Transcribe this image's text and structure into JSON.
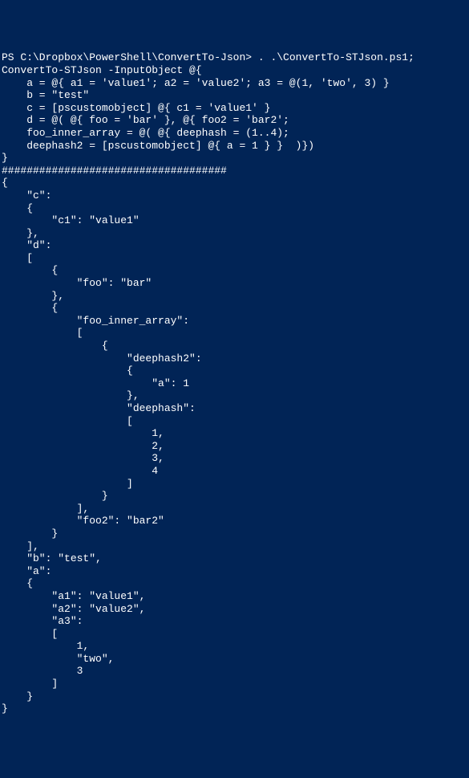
{
  "console": {
    "content": "PS C:\\Dropbox\\PowerShell\\ConvertTo-Json> . .\\ConvertTo-STJson.ps1;\nConvertTo-STJson -InputObject @{\n    a = @{ a1 = 'value1'; a2 = 'value2'; a3 = @(1, 'two', 3) }\n    b = \"test\"\n    c = [pscustomobject] @{ c1 = 'value1' }\n    d = @( @{ foo = 'bar' }, @{ foo2 = 'bar2';\n    foo_inner_array = @( @{ deephash = (1..4);\n    deephash2 = [pscustomobject] @{ a = 1 } }  )})\n}\n####################################\n{\n    \"c\":\n    {\n        \"c1\": \"value1\"\n    },\n    \"d\":\n    [\n        {\n            \"foo\": \"bar\"\n        },\n        {\n            \"foo_inner_array\":\n            [\n                {\n                    \"deephash2\":\n                    {\n                        \"a\": 1\n                    },\n                    \"deephash\":\n                    [\n                        1,\n                        2,\n                        3,\n                        4\n                    ]\n                }\n            ],\n            \"foo2\": \"bar2\"\n        }\n    ],\n    \"b\": \"test\",\n    \"a\":\n    {\n        \"a1\": \"value1\",\n        \"a2\": \"value2\",\n        \"a3\":\n        [\n            1,\n            \"two\",\n            3\n        ]\n    }\n}"
  }
}
